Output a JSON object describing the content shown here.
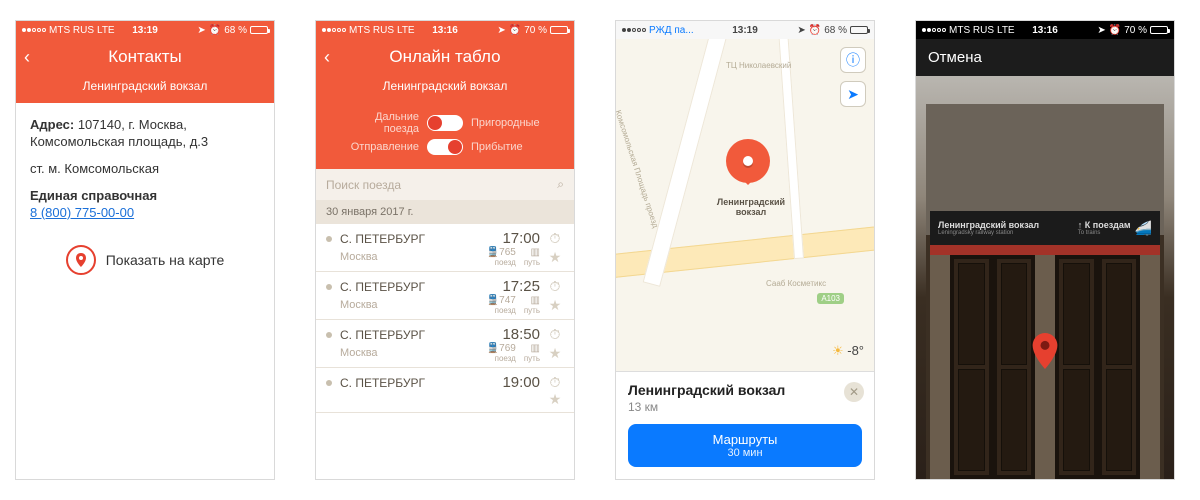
{
  "colors": {
    "accent": "#f15a3b",
    "ios_blue": "#0a7aff"
  },
  "s1": {
    "status": {
      "carrier": "MTS RUS",
      "net": "LTE",
      "time": "13:19",
      "battery_pct": "68 %"
    },
    "title": "Контакты",
    "station": "Ленинградский вокзал",
    "address_label": "Адрес:",
    "address": "107140, г. Москва, Комсомольская площадь, д.3",
    "metro": "ст. м. Комсомольская",
    "hotline_label": "Единая справочная",
    "hotline_phone": "8 (800) 775-00-00",
    "show_on_map": "Показать на карте"
  },
  "s2": {
    "status": {
      "carrier": "MTS RUS",
      "net": "LTE",
      "time": "13:16",
      "battery_pct": "70 %"
    },
    "title": "Онлайн табло",
    "station": "Ленинградский вокзал",
    "toggle1": {
      "left": "Дальние поезда",
      "right": "Пригородные"
    },
    "toggle2": {
      "left": "Отправление",
      "right": "Прибытие"
    },
    "search_placeholder": "Поиск поезда",
    "date_header": "30 января 2017 г.",
    "meta_labels": {
      "train": "поезд",
      "track": "путь"
    },
    "trains": [
      {
        "dest": "С. ПЕТЕРБУРГ",
        "orig": "Москва",
        "time": "17:00",
        "train_no": "765"
      },
      {
        "dest": "С. ПЕТЕРБУРГ",
        "orig": "Москва",
        "time": "17:25",
        "train_no": "747"
      },
      {
        "dest": "С. ПЕТЕРБУРГ",
        "orig": "Москва",
        "time": "18:50",
        "train_no": "769"
      },
      {
        "dest": "С. ПЕТЕРБУРГ",
        "orig": "",
        "time": "19:00",
        "train_no": ""
      }
    ]
  },
  "s3": {
    "status": {
      "app_back": "РЖД па...",
      "time": "13:19",
      "battery_pct": "68 %"
    },
    "pin_label": "Ленинградский\nвокзал",
    "temp": "-8°",
    "labels": {
      "tc": "ТЦ Николаевский",
      "saab": "Сааб Косметикс",
      "road": "Комсомольская Площадь проезд",
      "a103": "A103"
    },
    "card": {
      "title": "Ленинградский вокзал",
      "distance": "13 км",
      "route_label": "Маршруты",
      "route_eta": "30 мин"
    }
  },
  "s4": {
    "status": {
      "carrier": "MTS RUS",
      "net": "LTE",
      "time": "13:16",
      "battery_pct": "70 %"
    },
    "cancel": "Отмена",
    "sign": {
      "station_ru": "Ленинградский вокзал",
      "station_en": "Leningradsky railway station",
      "to_trains_ru": "К поездам",
      "to_trains_en": "To trains"
    }
  }
}
